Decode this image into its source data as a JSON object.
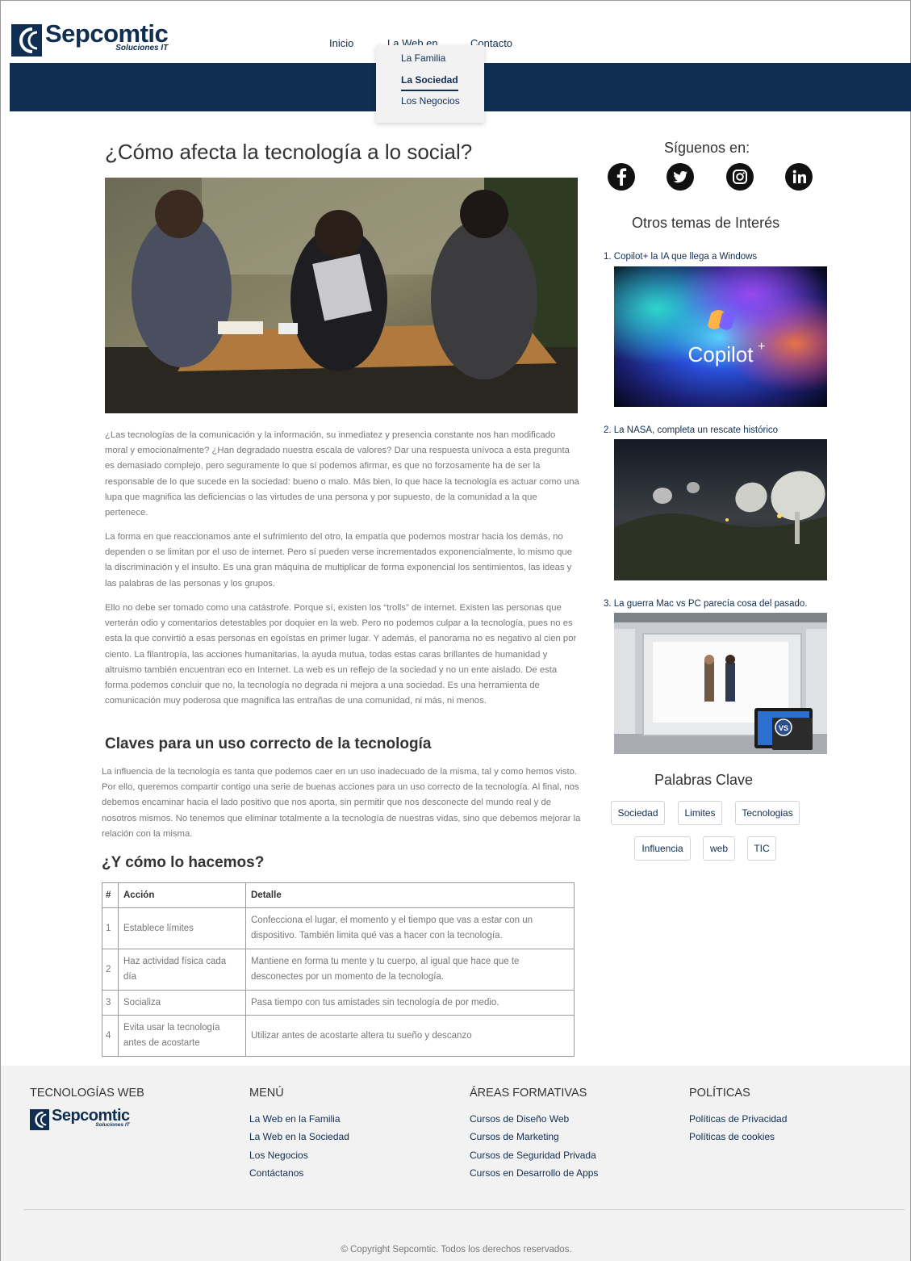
{
  "brand": {
    "name": "Sepcomtic",
    "tagline": "Soluciones IT"
  },
  "nav": {
    "items": [
      "Inicio",
      "La Web en",
      "Contacto"
    ],
    "dropdown": [
      "La Familia",
      "La Sociedad",
      "Los Negocios"
    ],
    "active_dropdown_item": "La Sociedad"
  },
  "article": {
    "title": "¿Cómo afecta la tecnología a lo social?",
    "paragraphs": [
      "¿Las tecnologías de la comunicación y la información, su inmediatez y presencia constante nos han modificado moral y emocionalmente? ¿Han degradado nuestra escala de valores? Dar una respuesta unívoca a esta pregunta es demasiado complejo, pero seguramente lo que sí podemos afirmar, es que no forzosamente ha de ser la responsable de lo que sucede en la sociedad: bueno o malo. Más bien, lo que hace la tecnología es actuar como una lupa que magnifica las deficiencias o las virtudes de una persona y por supuesto, de la comunidad a la que pertenece.",
      "La forma en que reaccionamos ante el sufrimiento del otro, la empatía que podemos mostrar hacia los demás, no dependen o se limitan por el uso de internet. Pero sí pueden verse incrementados exponencialmente, lo mismo que la discriminación y el insulto. Es una gran máquina de multiplicar de forma exponencial los sentimientos, las ideas y las palabras de las personas y los grupos.",
      "Ello no debe ser tomado como una catástrofe. Porque sí, existen los “trolls” de internet. Existen las personas que verterán odio y comentarios detestables por doquier en la web. Pero no podemos culpar a la tecnología, pues no es esta la que convirtió a esas personas en egoístas en primer lugar. Y además, el panorama no es negativo al cien por ciento. La filantropía, las acciones humanitarias, la ayuda mutua, todas estas caras brillantes de humanidad y altruismo también encuentran eco en Internet. La web es un reflejo de la sociedad y no un ente aislado. De esta forma podemos concluir que no, la tecnología no degrada ni mejora a una sociedad. Es una herramienta de comunicación muy poderosa que magnifica las entrañas de una comunidad, ni más, ni menos."
    ],
    "section2_title": "Claves para un uso correcto de la tecnología",
    "section2_text": "La influencia de la tecnología es tanta que podemos caer en un uso inadecuado de la misma, tal y como hemos visto. Por ello, queremos compartir contigo una serie de buenas acciones para un uso correcto de la tecnología. Al final, nos debemos encaminar hacia el lado positivo que nos aporta, sin permitir que nos desconecte del mundo real y de nosotros mismos. No tenemos que eliminar totalmente a la tecnología de nuestras vidas, sino que debemos mejorar la relación con la misma.",
    "section3_title": "¿Y cómo lo hacemos?",
    "table": {
      "headers": [
        "#",
        "Acción",
        "Detalle"
      ],
      "rows": [
        [
          "1",
          "Establece límites",
          "Confecciona el lugar, el momento y el tiempo que vas a estar con un dispositivo. También limita qué vas a hacer con la tecnología."
        ],
        [
          "2",
          "Haz actividad física cada día",
          "Mantiene en forma tu mente y tu cuerpo, al igual que hace que te desconectes por un momento de la tecnología."
        ],
        [
          "3",
          "Socializa",
          "Pasa tiempo con tus amistades sin tecnología de por medio."
        ],
        [
          "4",
          "Evita usar la tecnología antes de acostarte",
          "Utilizar antes de acostarte altera tu sueño y descanzo"
        ]
      ]
    }
  },
  "sidebar": {
    "follow_title": "Síguenos en:",
    "social": [
      "facebook-icon",
      "twitter-icon",
      "instagram-icon",
      "linkedin-icon"
    ],
    "topics_title": "Otros temas de Interés",
    "topics": [
      {
        "label": "1. Copilot+ la IA que llega a Windows",
        "image_text": "Copilot"
      },
      {
        "label": "2. La NASA, completa un rescate histórico"
      },
      {
        "label": "3. La guerra Mac vs PC parecía cosa del pasado.",
        "image_text": "VS"
      }
    ],
    "keywords_title": "Palabras Clave",
    "keywords": [
      "Sociedad",
      "Limites",
      "Tecnologias",
      "Influencia",
      "web",
      "TIC"
    ]
  },
  "footer": {
    "col1_title": "TECNOLOGÍAS WEB",
    "col2_title": "MENÚ",
    "col2_links": [
      "La Web en la Familia",
      "La Web en la Sociedad",
      "Los Negocios",
      "Contáctanos"
    ],
    "col3_title": "ÁREAS FORMATIVAS",
    "col3_links": [
      "Cursos de Diseño Web",
      "Cursos de Marketing",
      "Cursos de Seguridad Privada",
      "Cursos en Desarrollo de Apps"
    ],
    "col4_title": "POLÍTICAS",
    "col4_links": [
      "Políticas de Privacidad",
      "Políticas de cookies"
    ],
    "copyright": "© Copyright Sepcomtic. Todos los derechos reservados."
  },
  "colors": {
    "brand_navy": "#0f2e52",
    "footer_bg": "#f2f2f2",
    "text_muted": "#777777"
  }
}
